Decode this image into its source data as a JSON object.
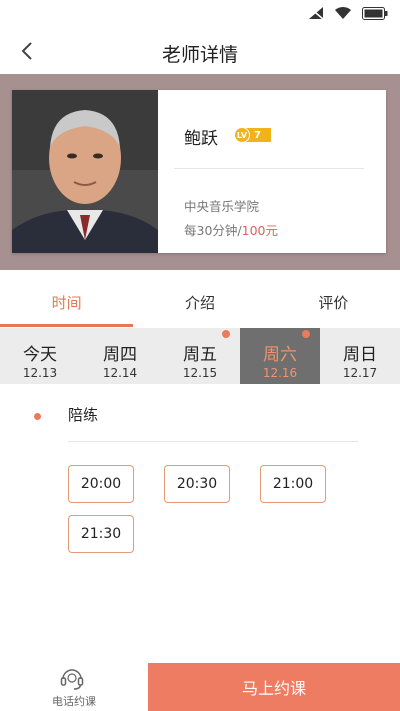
{
  "nav": {
    "title": "老师详情"
  },
  "teacher": {
    "name": "鲍跃",
    "level_prefix": "LV",
    "level": "7",
    "school": "中央音乐学院",
    "price_prefix": "每30分钟/",
    "price": "100元"
  },
  "tabs": [
    {
      "label": "时间"
    },
    {
      "label": "介绍"
    },
    {
      "label": "评价"
    }
  ],
  "dates": [
    {
      "day": "今天",
      "date": "12.13"
    },
    {
      "day": "周四",
      "date": "12.14"
    },
    {
      "day": "周五",
      "date": "12.15"
    },
    {
      "day": "周六",
      "date": "12.16"
    },
    {
      "day": "周日",
      "date": "12.17"
    }
  ],
  "session": {
    "label": "陪练",
    "slots": [
      "20:00",
      "20:30",
      "21:00",
      "21:30"
    ]
  },
  "bottom": {
    "phone_label": "电话约课",
    "book_label": "马上约课"
  },
  "colors": {
    "accent": "#e37a55",
    "card_bg": "#a69090",
    "book_button": "#ee7c62",
    "level_badge": "#f2b21c"
  }
}
